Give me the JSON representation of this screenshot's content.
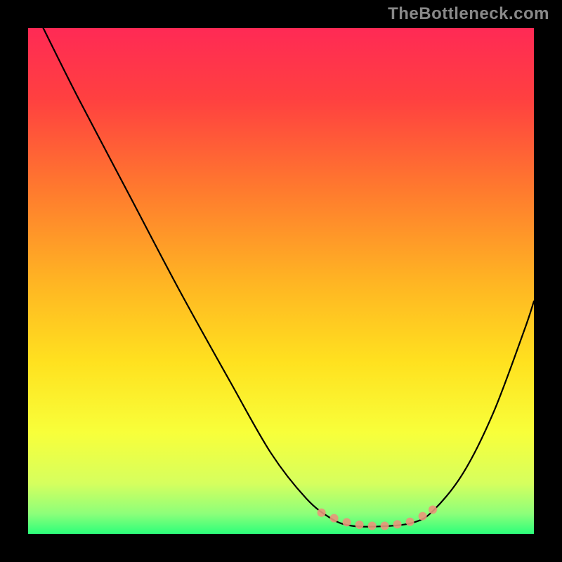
{
  "watermark": "TheBottleneck.com",
  "chart_data": {
    "type": "line",
    "title": "",
    "xlabel": "",
    "ylabel": "",
    "xlim": [
      0,
      100
    ],
    "ylim": [
      0,
      100
    ],
    "grid": false,
    "legend": false,
    "background_gradient": {
      "stops": [
        {
          "offset": 0.0,
          "color": "#ff2a55"
        },
        {
          "offset": 0.14,
          "color": "#ff4040"
        },
        {
          "offset": 0.32,
          "color": "#ff7a2e"
        },
        {
          "offset": 0.5,
          "color": "#ffb423"
        },
        {
          "offset": 0.66,
          "color": "#ffe11f"
        },
        {
          "offset": 0.8,
          "color": "#f8ff3a"
        },
        {
          "offset": 0.9,
          "color": "#d6ff5e"
        },
        {
          "offset": 0.96,
          "color": "#8dff7a"
        },
        {
          "offset": 1.0,
          "color": "#2cff7a"
        }
      ]
    },
    "series": [
      {
        "name": "curve",
        "color": "#000000",
        "width": 2.2,
        "points": [
          {
            "x": 3.0,
            "y": 100.0
          },
          {
            "x": 10.0,
            "y": 86.0
          },
          {
            "x": 20.0,
            "y": 67.0
          },
          {
            "x": 30.0,
            "y": 48.0
          },
          {
            "x": 40.0,
            "y": 30.0
          },
          {
            "x": 48.0,
            "y": 16.0
          },
          {
            "x": 55.0,
            "y": 7.0
          },
          {
            "x": 60.0,
            "y": 3.0
          },
          {
            "x": 64.0,
            "y": 1.6
          },
          {
            "x": 70.0,
            "y": 1.5
          },
          {
            "x": 76.0,
            "y": 2.2
          },
          {
            "x": 80.0,
            "y": 4.5
          },
          {
            "x": 86.0,
            "y": 12.0
          },
          {
            "x": 92.0,
            "y": 24.0
          },
          {
            "x": 98.0,
            "y": 40.0
          },
          {
            "x": 100.0,
            "y": 46.0
          }
        ]
      }
    ],
    "valley_marker": {
      "color": "#e9967a",
      "opacity": 0.9,
      "radius_px": 6,
      "points": [
        {
          "x": 58.0,
          "y": 4.2
        },
        {
          "x": 60.5,
          "y": 3.1
        },
        {
          "x": 63.0,
          "y": 2.3
        },
        {
          "x": 65.5,
          "y": 1.8
        },
        {
          "x": 68.0,
          "y": 1.6
        },
        {
          "x": 70.5,
          "y": 1.6
        },
        {
          "x": 73.0,
          "y": 1.9
        },
        {
          "x": 75.5,
          "y": 2.4
        },
        {
          "x": 78.0,
          "y": 3.5
        },
        {
          "x": 80.0,
          "y": 4.8
        }
      ]
    }
  }
}
